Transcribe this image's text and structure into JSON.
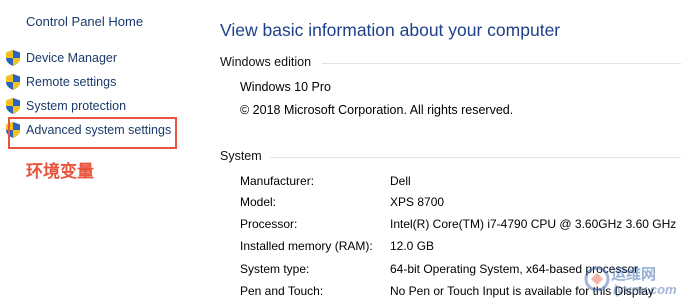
{
  "sidebar": {
    "home_link": "Control Panel Home",
    "items": [
      {
        "label": "Device Manager",
        "icon": "shield-icon"
      },
      {
        "label": "Remote settings",
        "icon": "shield-icon"
      },
      {
        "label": "System protection",
        "icon": "shield-icon"
      },
      {
        "label": "Advanced system settings",
        "icon": "shield-icon"
      }
    ],
    "annotation": "环境变量",
    "annotation_color": "#e8553c"
  },
  "main": {
    "heading": "View basic information about your computer",
    "windows_edition": {
      "title": "Windows edition",
      "edition": "Windows 10 Pro",
      "copyright": "© 2018 Microsoft Corporation. All rights reserved."
    },
    "system": {
      "title": "System",
      "rows": [
        {
          "key": "Manufacturer:",
          "value": "Dell"
        },
        {
          "key": "Model:",
          "value": "XPS 8700"
        },
        {
          "key": "Processor:",
          "value": "Intel(R) Core(TM) i7-4790 CPU @ 3.60GHz   3.60 GHz"
        },
        {
          "key": "Installed memory (RAM):",
          "value": "12.0 GB"
        },
        {
          "key": "System type:",
          "value": "64-bit Operating System, x64-based processor"
        },
        {
          "key": "Pen and Touch:",
          "value": "No Pen or Touch Input is available for this Display"
        }
      ]
    }
  },
  "watermark": {
    "line1": "运维网",
    "line2": "iyunv.com"
  },
  "colors": {
    "link": "#1a3a6b",
    "heading": "#1e3f8a",
    "highlight": "#e8553c"
  }
}
